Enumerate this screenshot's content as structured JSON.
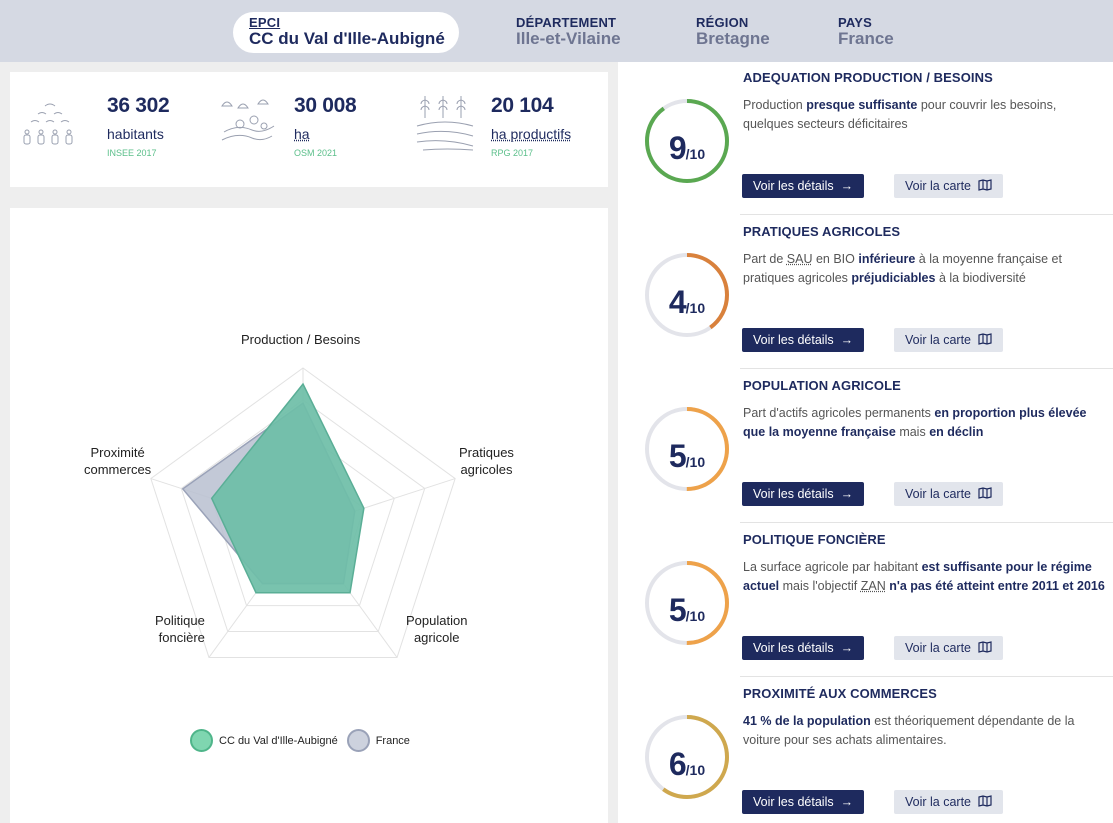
{
  "scopes": [
    {
      "label": "EPCI",
      "value": "CC du Val d'Ille-Aubigné",
      "active": true
    },
    {
      "label": "DÉPARTEMENT",
      "value": "Ille-et-Vilaine",
      "active": false
    },
    {
      "label": "RÉGION",
      "value": "Bretagne",
      "active": false
    },
    {
      "label": "PAYS",
      "value": "France",
      "active": false
    }
  ],
  "stats": [
    {
      "icon": "population-icon",
      "value": "36 302",
      "unit": "habitants",
      "source": "INSEE 2017"
    },
    {
      "icon": "landscape-icon",
      "value": "30 008",
      "unit": "ha",
      "source": "OSM 2021"
    },
    {
      "icon": "crops-icon",
      "value": "20 104",
      "unit": "ha productifs",
      "source": "RPG 2017"
    }
  ],
  "chart_data": {
    "type": "radar",
    "axes": [
      "Production / Besoins",
      "Pratiques agricoles",
      "Population agricole",
      "Politique foncière",
      "Proximité commerces"
    ],
    "axis_labels_display": [
      "Production / Besoins",
      "Pratiques\nagricoles",
      "Population\nagricole",
      "Politique\nfoncière",
      "Proximité\ncommerces"
    ],
    "range": [
      0,
      10
    ],
    "rings": 5,
    "series": [
      {
        "name": "France",
        "values": [
          7.8,
          3.4,
          4.3,
          4.3,
          7.9
        ],
        "color": "#b9bfd0"
      },
      {
        "name": "CC du Val d'Ille-Aubigné",
        "values": [
          9,
          4,
          5,
          5,
          6
        ],
        "color": "#6ebea7"
      }
    ]
  },
  "legend": {
    "local": {
      "label": "CC du Val d'Ille-Aubigné",
      "color": "#7fd6b0"
    },
    "france": {
      "label": "France",
      "color": "#cdd2de"
    }
  },
  "cards": [
    {
      "title": "ADEQUATION PRODUCTION / BESOINS",
      "score": "9",
      "out_of": "/10",
      "score_fraction": 0.9,
      "color": "#5aa851",
      "desc_html": "Production <b>presque suffisante</b> pour couvrir les besoins, quelques secteurs déficitaires"
    },
    {
      "title": "PRATIQUES AGRICOLES",
      "score": "4",
      "out_of": "/10",
      "score_fraction": 0.4,
      "color": "#d9813c",
      "desc_html": "Part de <span class=\"ul\">SAU</span> en BIO <b>inférieure</b> à la moyenne française et pratiques agricoles <b>préjudiciables</b> à la biodiversité"
    },
    {
      "title": "POPULATION AGRICOLE",
      "score": "5",
      "out_of": "/10",
      "score_fraction": 0.5,
      "color": "#eea24a",
      "desc_html": "Part d'actifs agricoles permanents <b>en proportion plus élevée que la moyenne française</b> mais <b>en déclin</b>"
    },
    {
      "title": "POLITIQUE FONCIÈRE",
      "score": "5",
      "out_of": "/10",
      "score_fraction": 0.5,
      "color": "#eea24a",
      "desc_html": "La surface agricole par habitant <b>est suffisante pour le régime actuel</b> mais l'objectif <span class=\"ul\">ZAN</span> <b>n'a pas été atteint entre 2011 et 2016</b>"
    },
    {
      "title": "PROXIMITÉ AUX COMMERCES",
      "score": "6",
      "out_of": "/10",
      "score_fraction": 0.6,
      "color": "#cfa84e",
      "desc_html": "<b>41 % de la population</b> est théoriquement dépendante de la voiture pour ses achats alimentaires."
    }
  ],
  "buttons": {
    "details": "Voir les détails",
    "details_arrow": "→",
    "map": "Voir la carte",
    "map_icon": "map-icon"
  }
}
